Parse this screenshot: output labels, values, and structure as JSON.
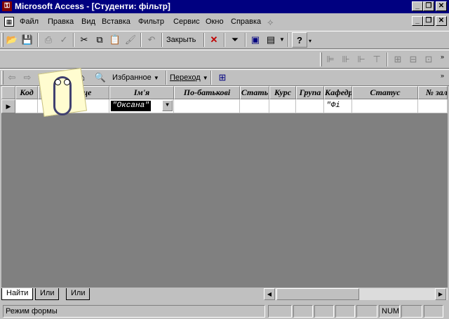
{
  "window": {
    "title": "Microsoft Access - [Студенти: фільтр]"
  },
  "menu": [
    {
      "label": "Файл"
    },
    {
      "label": "Правка"
    },
    {
      "label": "Вид"
    },
    {
      "label": "Вставка"
    },
    {
      "label": "Фильтр"
    },
    {
      "label": "Сервис"
    },
    {
      "label": "Окно"
    },
    {
      "label": "Справка"
    }
  ],
  "toolbar": {
    "close_label": "Закрыть"
  },
  "web_toolbar": {
    "favorites_label": "Избранное",
    "go_label": "Переход"
  },
  "grid": {
    "columns": [
      {
        "label": "Код"
      },
      {
        "label": "Прізвище"
      },
      {
        "label": "Ім'я"
      },
      {
        "label": "По-батькові"
      },
      {
        "label": "Стать"
      },
      {
        "label": "Курс"
      },
      {
        "label": "Група"
      },
      {
        "label": "Кафедра"
      },
      {
        "label": "Статус"
      },
      {
        "label": "№ зал"
      }
    ],
    "row": {
      "imya_value": "\"Оксана\"",
      "kafedra_value": "\"Фі"
    }
  },
  "tabs": [
    {
      "label": "Найти"
    },
    {
      "label": "Или"
    },
    {
      "label": "Или"
    }
  ],
  "status": {
    "mode": "Режим формы",
    "num": "NUM"
  },
  "colors": {
    "titlebar": "#000080",
    "face": "#c0c0c0",
    "grid_bg": "#808080"
  }
}
